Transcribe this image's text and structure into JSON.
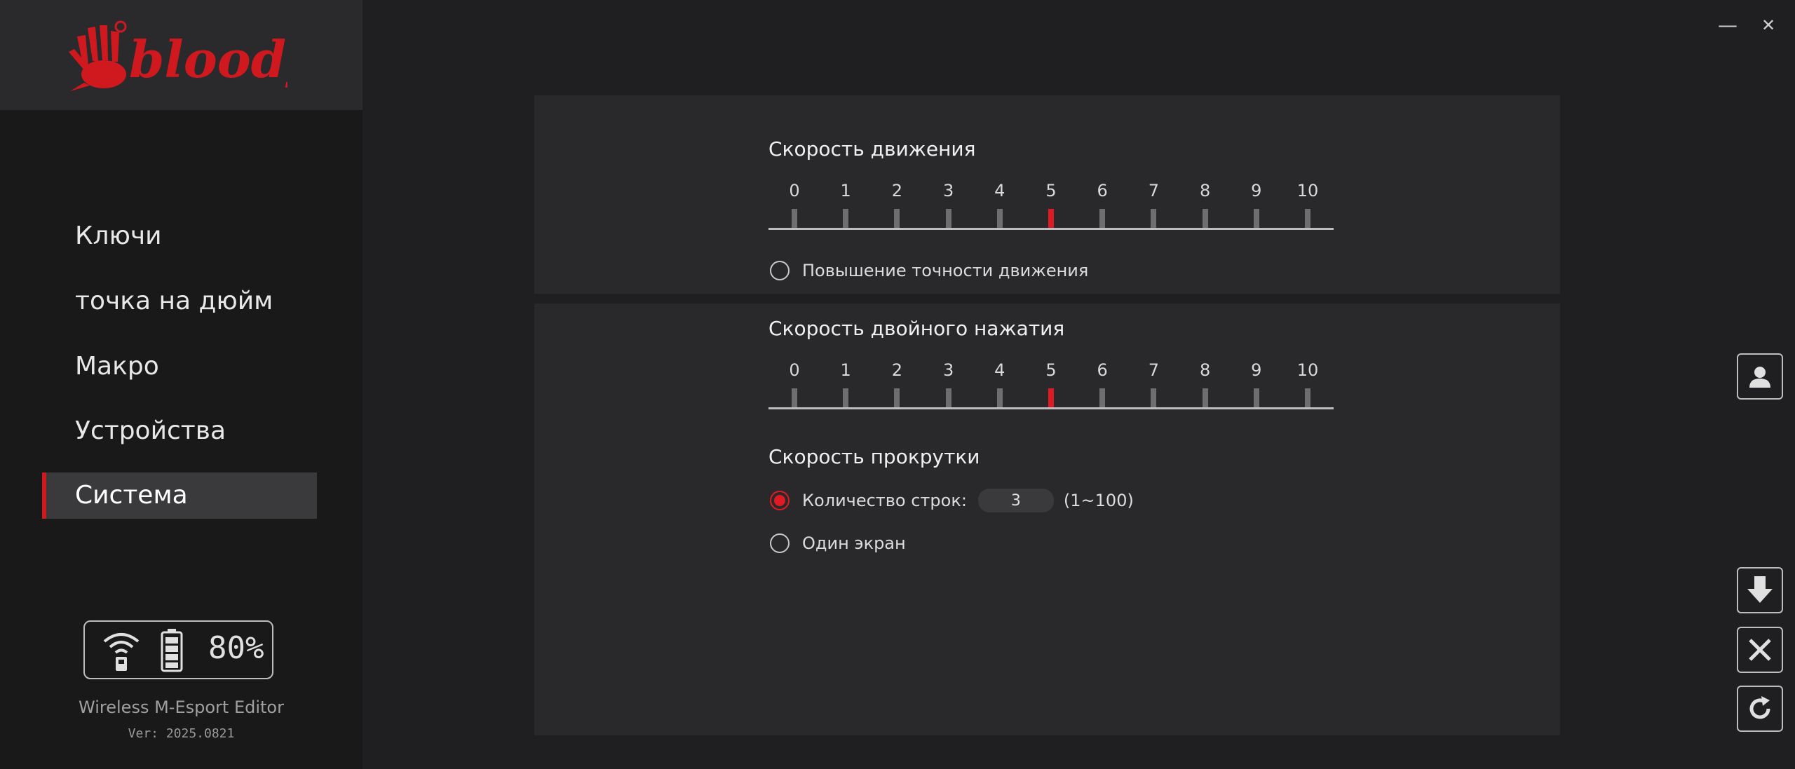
{
  "window": {
    "minimize_glyph": "—",
    "close_glyph": "✕"
  },
  "brand": {
    "logo_text": "bloody",
    "logo_color": "#d0191f"
  },
  "sidebar": {
    "items": [
      {
        "label": "Ключи",
        "active": false
      },
      {
        "label": "точка на дюйм",
        "active": false
      },
      {
        "label": "Макро",
        "active": false
      },
      {
        "label": "Устройства",
        "active": false
      },
      {
        "label": "Система",
        "active": true
      }
    ],
    "status": {
      "connection": "wireless-icon",
      "battery": "battery-icon",
      "battery_percent": "80%"
    },
    "editor_name": "Wireless M-Esport Editor",
    "version": "Ver: 2025.0821"
  },
  "system": {
    "movement_speed": {
      "title": "Скорость движения",
      "scale": [
        "0",
        "1",
        "2",
        "3",
        "4",
        "5",
        "6",
        "7",
        "8",
        "9",
        "10"
      ],
      "value": 5
    },
    "precision": {
      "label": "Повышение точности движения",
      "checked": false
    },
    "double_click_speed": {
      "title": "Скорость двойного нажатия",
      "scale": [
        "0",
        "1",
        "2",
        "3",
        "4",
        "5",
        "6",
        "7",
        "8",
        "9",
        "10"
      ],
      "value": 5
    },
    "scroll_speed": {
      "title": "Скорость прокрутки",
      "lines_label": "Количество строк:",
      "lines_value": "3",
      "lines_range": "(1~100)",
      "lines_checked": true,
      "one_screen_label": "Один экран",
      "one_screen_checked": false
    }
  },
  "actions": [
    "user-icon",
    "download-icon",
    "close-icon",
    "refresh-icon"
  ],
  "accent_color": "#e01a22"
}
